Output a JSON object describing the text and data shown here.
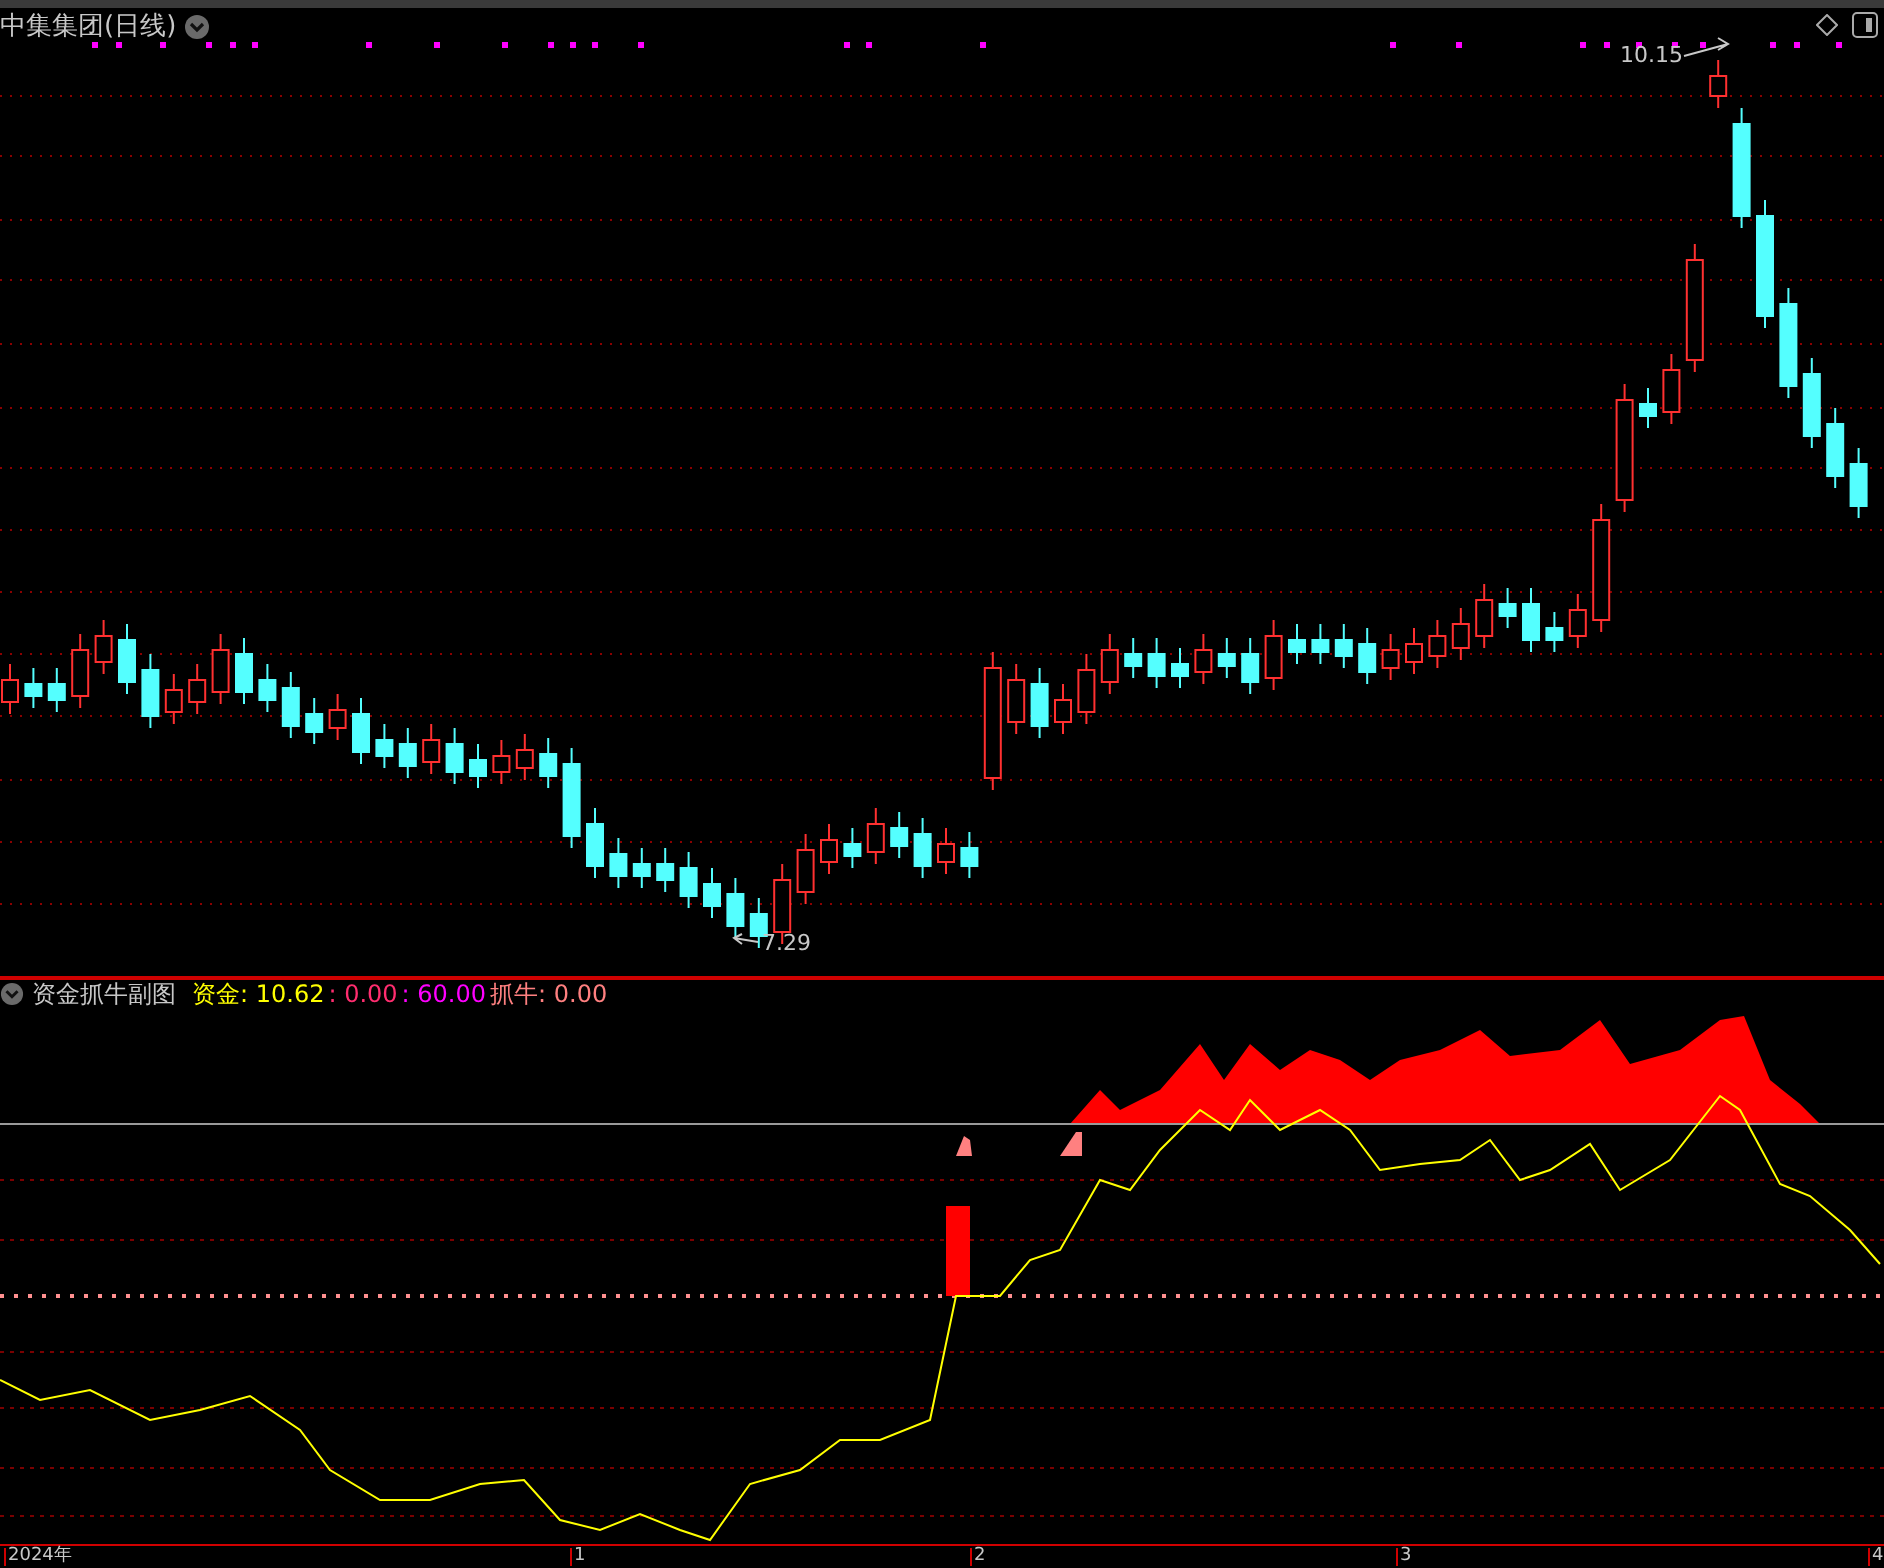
{
  "main_chart": {
    "title": "中集集团(日线)",
    "high_label": "10.15",
    "low_label": "7.29"
  },
  "indicator": {
    "name": "资金抓牛副图",
    "legend": [
      {
        "text": "资金: 10.62",
        "color": "#ffff00"
      },
      {
        "text": ": 0.00",
        "color": "#ff2d6f"
      },
      {
        "text": ": 60.00",
        "color": "#ff00ff"
      },
      {
        "text": "抓牛: 0.00",
        "color": "#ff8080"
      }
    ]
  },
  "time_axis": [
    "2024年",
    "1",
    "2",
    "3",
    "4"
  ]
}
